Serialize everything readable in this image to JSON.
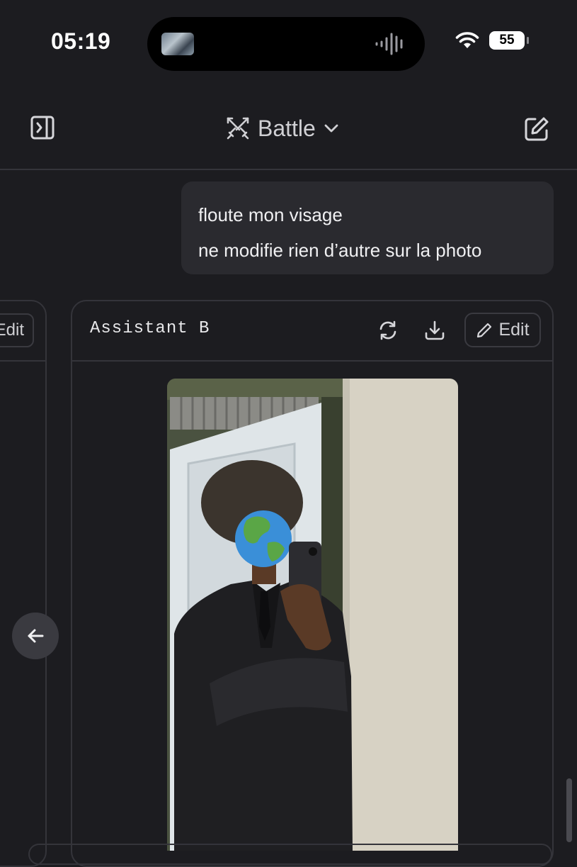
{
  "status_bar": {
    "time": "05:19",
    "battery": "55"
  },
  "header": {
    "mode_label": "Battle"
  },
  "user_message": {
    "lines": [
      "floute mon visage",
      "ne modifie rien d’autre sur la photo"
    ]
  },
  "left_card": {
    "edit_label": "Edit"
  },
  "assistant_card": {
    "title": "Assistant B",
    "edit_label": "Edit"
  },
  "colors": {
    "background": "#1c1c20",
    "bubble": "#2a2a2f",
    "border": "#34343a"
  },
  "icons": [
    "sidebar-toggle-icon",
    "swords-icon",
    "chevron-down-icon",
    "compose-icon",
    "refresh-icon",
    "download-icon",
    "pencil-icon",
    "arrow-left-icon",
    "wifi-icon",
    "audio-wave-icon"
  ]
}
